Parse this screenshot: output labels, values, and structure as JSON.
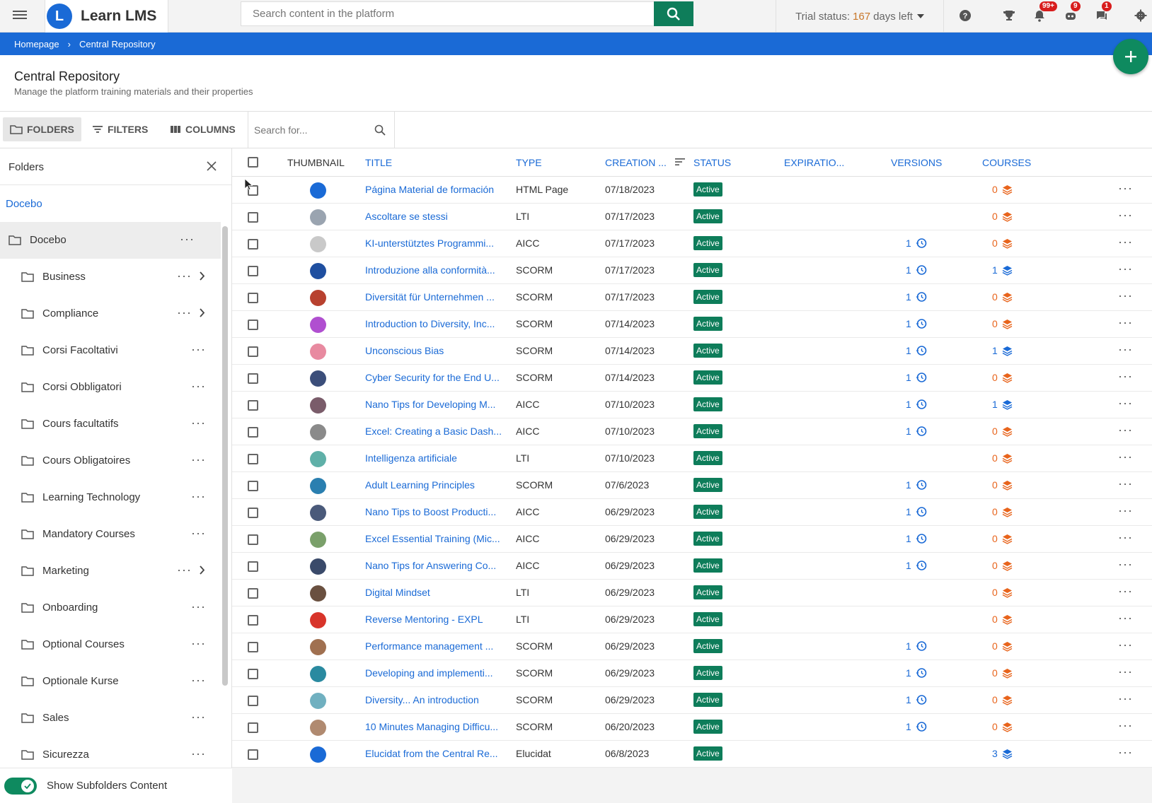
{
  "app": {
    "name": "Learn LMS",
    "logo_letter": "L"
  },
  "search": {
    "placeholder": "Search content in the platform"
  },
  "trial": {
    "label": "Trial status:",
    "days": "167",
    "suffix": "days left"
  },
  "notifications": {
    "bell_badge": "99+",
    "robot_badge": "9",
    "chat_badge": "1"
  },
  "breadcrumb": {
    "home": "Homepage",
    "current": "Central Repository"
  },
  "page": {
    "title": "Central Repository",
    "subtitle": "Manage the platform training materials and their properties"
  },
  "toolbar": {
    "folders": "FOLDERS",
    "filters": "FILTERS",
    "columns": "COLUMNS",
    "search_placeholder": "Search for..."
  },
  "sidebar": {
    "title": "Folders",
    "root": "Docebo",
    "folders": [
      {
        "label": "Docebo",
        "chevron": false
      },
      {
        "label": "Business",
        "chevron": true
      },
      {
        "label": "Compliance",
        "chevron": true
      },
      {
        "label": "Corsi Facoltativi",
        "chevron": false
      },
      {
        "label": "Corsi Obbligatori",
        "chevron": false
      },
      {
        "label": "Cours facultatifs",
        "chevron": false
      },
      {
        "label": "Cours Obligatoires",
        "chevron": false
      },
      {
        "label": "Learning Technology",
        "chevron": false
      },
      {
        "label": "Mandatory Courses",
        "chevron": false
      },
      {
        "label": "Marketing",
        "chevron": true
      },
      {
        "label": "Onboarding",
        "chevron": false
      },
      {
        "label": "Optional Courses",
        "chevron": false
      },
      {
        "label": "Optionale Kurse",
        "chevron": false
      },
      {
        "label": "Sales",
        "chevron": false
      },
      {
        "label": "Sicurezza",
        "chevron": false
      }
    ],
    "show_subfolders": "Show Subfolders Content"
  },
  "table": {
    "headers": {
      "thumbnail": "THUMBNAIL",
      "title": "TITLE",
      "type": "TYPE",
      "creation": "CREATION ...",
      "status": "STATUS",
      "expiration": "EXPIRATIO...",
      "versions": "VERSIONS",
      "courses": "COURSES"
    },
    "rows": [
      {
        "title": "Página Material de formación",
        "type": "HTML Page",
        "date": "07/18/2023",
        "status": "Active",
        "versions": "",
        "courses": "0",
        "thumb": "#1a6ad6"
      },
      {
        "title": "Ascoltare se stessi",
        "type": "LTI",
        "date": "07/17/2023",
        "status": "Active",
        "versions": "",
        "courses": "0",
        "thumb": "#9aa4b0"
      },
      {
        "title": "KI-unterstütztes Programmi...",
        "type": "AICC",
        "date": "07/17/2023",
        "status": "Active",
        "versions": "1",
        "courses": "0",
        "thumb": "#c9c9c9"
      },
      {
        "title": "Introduzione alla conformità...",
        "type": "SCORM",
        "date": "07/17/2023",
        "status": "Active",
        "versions": "1",
        "courses": "1",
        "thumb": "#1f4fa0"
      },
      {
        "title": "Diversität für Unternehmen ...",
        "type": "SCORM",
        "date": "07/17/2023",
        "status": "Active",
        "versions": "1",
        "courses": "0",
        "thumb": "#b8412f"
      },
      {
        "title": "Introduction to Diversity, Inc...",
        "type": "SCORM",
        "date": "07/14/2023",
        "status": "Active",
        "versions": "1",
        "courses": "0",
        "thumb": "#b04fd0"
      },
      {
        "title": "Unconscious Bias",
        "type": "SCORM",
        "date": "07/14/2023",
        "status": "Active",
        "versions": "1",
        "courses": "1",
        "thumb": "#e88aa0"
      },
      {
        "title": "Cyber Security for the End U...",
        "type": "SCORM",
        "date": "07/14/2023",
        "status": "Active",
        "versions": "1",
        "courses": "0",
        "thumb": "#3b4e7a"
      },
      {
        "title": "Nano Tips for Developing M...",
        "type": "AICC",
        "date": "07/10/2023",
        "status": "Active",
        "versions": "1",
        "courses": "1",
        "thumb": "#7a5c6a"
      },
      {
        "title": "Excel: Creating a Basic Dash...",
        "type": "AICC",
        "date": "07/10/2023",
        "status": "Active",
        "versions": "1",
        "courses": "0",
        "thumb": "#8a8a8a"
      },
      {
        "title": "Intelligenza artificiale",
        "type": "LTI",
        "date": "07/10/2023",
        "status": "Active",
        "versions": "",
        "courses": "0",
        "thumb": "#5fb0a8"
      },
      {
        "title": "Adult Learning Principles",
        "type": "SCORM",
        "date": "07/6/2023",
        "status": "Active",
        "versions": "1",
        "courses": "0",
        "thumb": "#2a7fb0"
      },
      {
        "title": "Nano Tips to Boost Producti...",
        "type": "AICC",
        "date": "06/29/2023",
        "status": "Active",
        "versions": "1",
        "courses": "0",
        "thumb": "#4a5a7a"
      },
      {
        "title": "Excel Essential Training (Mic...",
        "type": "AICC",
        "date": "06/29/2023",
        "status": "Active",
        "versions": "1",
        "courses": "0",
        "thumb": "#7aa06a"
      },
      {
        "title": "Nano Tips for Answering Co...",
        "type": "AICC",
        "date": "06/29/2023",
        "status": "Active",
        "versions": "1",
        "courses": "0",
        "thumb": "#3a4a6a"
      },
      {
        "title": "Digital Mindset",
        "type": "LTI",
        "date": "06/29/2023",
        "status": "Active",
        "versions": "",
        "courses": "0",
        "thumb": "#6a5040"
      },
      {
        "title": "Reverse Mentoring - EXPL",
        "type": "LTI",
        "date": "06/29/2023",
        "status": "Active",
        "versions": "",
        "courses": "0",
        "thumb": "#d8342a"
      },
      {
        "title": "Performance management ...",
        "type": "SCORM",
        "date": "06/29/2023",
        "status": "Active",
        "versions": "1",
        "courses": "0",
        "thumb": "#a07050"
      },
      {
        "title": "Developing and implementi...",
        "type": "SCORM",
        "date": "06/29/2023",
        "status": "Active",
        "versions": "1",
        "courses": "0",
        "thumb": "#2a8aa0"
      },
      {
        "title": "Diversity... An introduction",
        "type": "SCORM",
        "date": "06/29/2023",
        "status": "Active",
        "versions": "1",
        "courses": "0",
        "thumb": "#70b0c0"
      },
      {
        "title": "10 Minutes Managing Difficu...",
        "type": "SCORM",
        "date": "06/20/2023",
        "status": "Active",
        "versions": "1",
        "courses": "0",
        "thumb": "#b08a70"
      },
      {
        "title": "Elucidat from the Central Re...",
        "type": "Elucidat",
        "date": "06/8/2023",
        "status": "Active",
        "versions": "",
        "courses": "3",
        "thumb": "#1a6ad6"
      }
    ]
  },
  "colors": {
    "brand": "#1a6ad6",
    "accent_green": "#0e7d5a",
    "orange": "#e8641c",
    "badge_red": "#d81c1c"
  }
}
